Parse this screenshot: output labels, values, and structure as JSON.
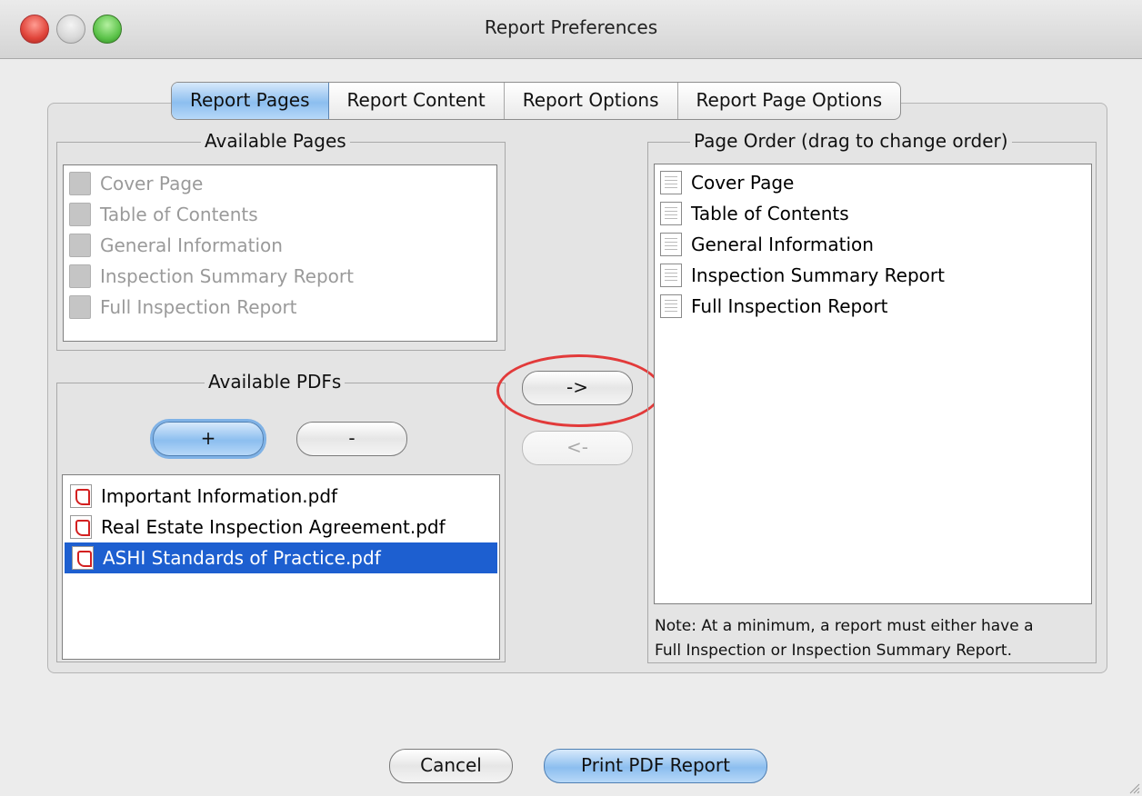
{
  "window": {
    "title": "Report Preferences"
  },
  "tabs": [
    {
      "label": "Report Pages",
      "active": true
    },
    {
      "label": "Report Content",
      "active": false
    },
    {
      "label": "Report Options",
      "active": false
    },
    {
      "label": "Report Page Options",
      "active": false
    }
  ],
  "available_pages": {
    "title": "Available Pages",
    "items": [
      "Cover Page",
      "Table of Contents",
      "General Information",
      "Inspection Summary Report",
      "Full Inspection Report"
    ]
  },
  "available_pdfs": {
    "title": "Available PDFs",
    "add_label": "+",
    "remove_label": "-",
    "items": [
      "Important Information.pdf",
      "Real Estate Inspection Agreement.pdf",
      "ASHI Standards of Practice.pdf"
    ],
    "selected_index": 2
  },
  "move_buttons": {
    "add_label": "->",
    "remove_label": "<-"
  },
  "page_order": {
    "title": "Page Order (drag to change order)",
    "items": [
      "Cover Page",
      "Table of Contents",
      "General Information",
      "Inspection Summary Report",
      "Full Inspection Report"
    ],
    "note_line1": "Note: At a minimum, a report must either have a",
    "note_line2": "Full Inspection or Inspection Summary Report."
  },
  "footer": {
    "cancel_label": "Cancel",
    "print_label": "Print PDF Report"
  },
  "colors": {
    "selection": "#1d5fd0",
    "annotation_circle": "#e23a3a",
    "tab_active": "#8cbeef"
  }
}
